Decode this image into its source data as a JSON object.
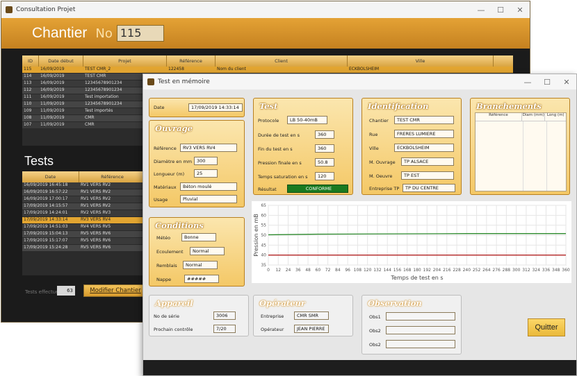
{
  "back_window": {
    "title": "Consultation Projet",
    "chantier_label": "Chantier",
    "no_label": "No",
    "no_value": "115",
    "projects_columns": [
      "ID",
      "Date début",
      "Projet",
      "Référence",
      "Client",
      "Ville"
    ],
    "projects_rows": [
      [
        "115",
        "16/09/2019",
        "TEST CMR_2",
        "122458",
        "Nom du client",
        "ECKBOLSHEIM"
      ],
      [
        "114",
        "16/09/2019",
        "TEST CMR",
        "",
        "",
        ""
      ],
      [
        "113",
        "16/09/2019",
        "12345678901234",
        "",
        "",
        ""
      ],
      [
        "112",
        "16/09/2019",
        "12345678901234",
        "",
        "",
        ""
      ],
      [
        "111",
        "16/09/2019",
        "Test importation",
        "",
        "",
        ""
      ],
      [
        "110",
        "11/09/2019",
        "12345678901234",
        "",
        "",
        ""
      ],
      [
        "109",
        "11/09/2019",
        "Test importés",
        "",
        "",
        ""
      ],
      [
        "108",
        "11/09/2019",
        "CMR",
        "",
        "",
        ""
      ],
      [
        "107",
        "11/09/2019",
        "CMR",
        "",
        "",
        ""
      ]
    ],
    "tests_title": "Tests",
    "tests_columns": [
      "Date",
      "Référence"
    ],
    "tests_rows": [
      [
        "16/09/2019 16:45:18",
        "RV1 VERS RV2"
      ],
      [
        "16/09/2019 16:57:22",
        "RV1 VERS RV2"
      ],
      [
        "16/09/2019 17:00:17",
        "RV1 VERS RV2"
      ],
      [
        "17/09/2019 14:15:57",
        "RV1 VERS RV2"
      ],
      [
        "17/09/2019 14:24:01",
        "RV2 VERS RV3"
      ],
      [
        "17/09/2019 14:33:14",
        "RV3 VERS RV4"
      ],
      [
        "17/09/2019 14:51:03",
        "RV4 VERS RV5"
      ],
      [
        "17/09/2019 15:04:13",
        "RV5 VERS RV6"
      ],
      [
        "17/09/2019 15:17:07",
        "RV5 VERS RV6"
      ],
      [
        "17/09/2019 15:24:28",
        "RV5 VERS RV6"
      ]
    ],
    "count_label": "Tests effectués",
    "count_value": "63",
    "modifier_label": "Modifier Chantier"
  },
  "front_window": {
    "title": "Test en mémoire",
    "date_label": "Date",
    "date_value": "17/09/2019 14:33:14",
    "ouvrage": {
      "title": "Ouvrage",
      "reference_label": "Référence",
      "reference_value": "RV3 VERS RV4",
      "diametre_label": "Diamètre en mm",
      "diametre_value": "300",
      "longueur_label": "Longueur (m)",
      "longueur_value": "25",
      "materiaux_label": "Matériaux",
      "materiaux_value": "Béton moulé",
      "usage_label": "Usage",
      "usage_value": "Pluvial"
    },
    "conditions": {
      "title": "Conditions",
      "meteo_label": "Météo",
      "meteo_value": "Bonne",
      "ecoulement_label": "Ecoulement",
      "ecoulement_value": "Normal",
      "remblais_label": "Remblais",
      "remblais_value": "Normal",
      "nappe_label": "Nappe",
      "nappe_value": "#####"
    },
    "test": {
      "title": "Test",
      "protocole_label": "Protocole",
      "protocole_value": "LB 50-40mB",
      "duree_label": "Durée de test en s",
      "duree_value": "360",
      "fin_label": "Fin du test en s",
      "fin_value": "360",
      "pression_label": "Pression finale en s",
      "pression_value": "50.8",
      "saturation_label": "Temps saturation en s",
      "saturation_value": "120",
      "resultat_label": "Résultat",
      "resultat_value": "CONFORME"
    },
    "identification": {
      "title": "Identification",
      "chantier_label": "Chantier",
      "chantier_value": "TEST CMR",
      "rue_label": "Rue",
      "rue_value": "FRERES LUMIERE",
      "ville_label": "Ville",
      "ville_value": "ECKBOLSHEIM",
      "mouvrage_label": "M. Ouvrage",
      "mouvrage_value": "TP ALSACE",
      "moeuvre_label": "M. Oeuvre",
      "moeuvre_value": "TP EST",
      "entreprise_label": "Entreprise TP",
      "entreprise_value": "TP DU CENTRE"
    },
    "branchements": {
      "title": "Branchements",
      "columns": [
        "Référence",
        "Diam (mm)",
        "Long (m)"
      ]
    },
    "appareil": {
      "title": "Appareil",
      "serie_label": "No de série",
      "serie_value": "3006",
      "controle_label": "Prochain contrôle",
      "controle_value": "7/20"
    },
    "operateur": {
      "title": "Opérateur",
      "entreprise_label": "Entreprise",
      "entreprise_value": "CMR SMR",
      "operateur_label": "Opérateur",
      "operateur_value": "JEAN PIERRE"
    },
    "observation": {
      "title": "Observation",
      "obs1_label": "Obs1",
      "obs2_label": "Obs2",
      "obs3_label": "Obs2"
    },
    "quit_label": "Quitter"
  },
  "colors": {
    "accent": "#e2a531",
    "conforme": "#1a7a20",
    "series_pressure": "#2e8b2e",
    "series_limit": "#b22222"
  },
  "chart_data": {
    "type": "line",
    "xlabel": "Temps de test en s",
    "ylabel": "Pression en mB",
    "xlim": [
      0,
      360
    ],
    "ylim": [
      35,
      65
    ],
    "xticks": [
      0,
      12,
      24,
      36,
      48,
      60,
      72,
      84,
      96,
      108,
      120,
      132,
      144,
      156,
      168,
      180,
      192,
      204,
      216,
      228,
      240,
      252,
      264,
      276,
      288,
      300,
      312,
      324,
      336,
      348,
      360
    ],
    "yticks": [
      35,
      40,
      45,
      50,
      55,
      60,
      65
    ],
    "grid": true,
    "series": [
      {
        "color": "#2e8b2e",
        "x": [
          0,
          60,
          120,
          180,
          240,
          300,
          360
        ],
        "y": [
          50.2,
          50.5,
          50.6,
          50.7,
          50.8,
          50.8,
          50.8
        ]
      },
      {
        "color": "#b22222",
        "x": [
          0,
          360
        ],
        "y": [
          40,
          40
        ]
      }
    ]
  }
}
